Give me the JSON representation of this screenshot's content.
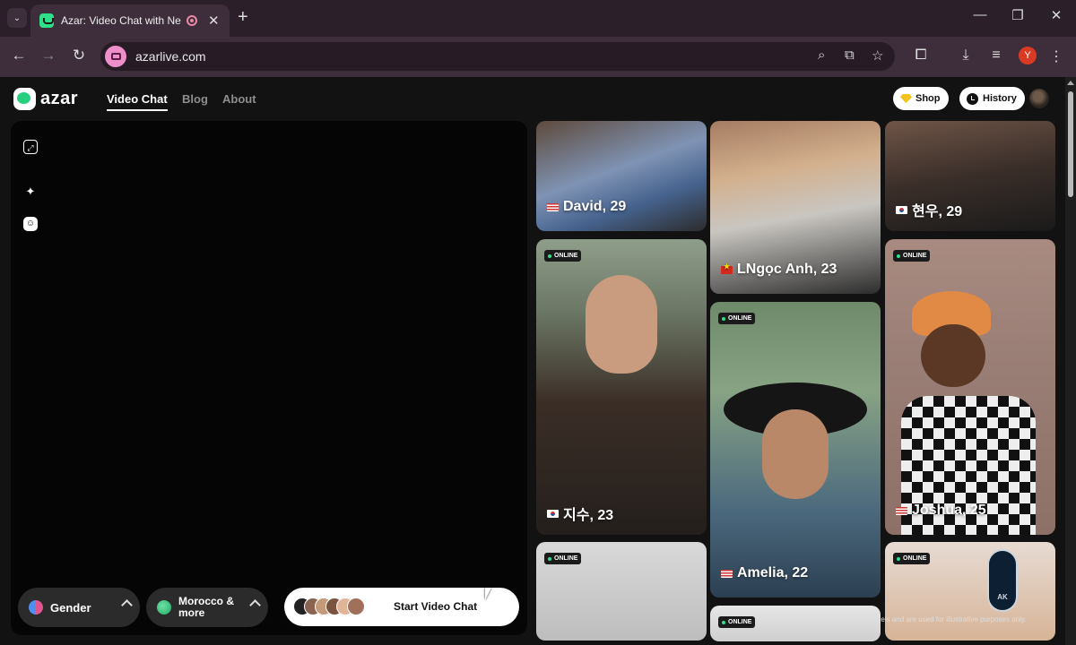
{
  "browser": {
    "tab_title": "Azar: Video Chat with New Pe",
    "url": "azarlive.com",
    "profile_initial": "Y"
  },
  "header": {
    "logo_text": "azar",
    "nav": [
      "Video Chat",
      "Blog",
      "About"
    ],
    "shop_label": "Shop",
    "history_label": "History"
  },
  "controls": {
    "gender_label": "Gender",
    "region_label": "Morocco & more",
    "start_label": "Start Video Chat"
  },
  "profiles": [
    {
      "name": "David, 29",
      "flag": "us",
      "online": false
    },
    {
      "name": "LNgọc Anh, 23",
      "flag": "vn",
      "online": false
    },
    {
      "name": "현우, 29",
      "flag": "kr",
      "online": false
    },
    {
      "name": "지수, 23",
      "flag": "kr",
      "online": true
    },
    {
      "name": "Amelia, 22",
      "flag": "us",
      "online": true
    },
    {
      "name": "Joshua, 25",
      "flag": "us",
      "online": true
    }
  ],
  "online_label": "ONLINE",
  "disclaimer": "All images are of models and are used for illustrative purposes only.",
  "watermark_text": "AK",
  "colors": {
    "accent_green": "#26d07c",
    "online_dot": "#2ee08a",
    "shop_gem": "#f3c21d",
    "profile_avatar": "#d93a23"
  }
}
